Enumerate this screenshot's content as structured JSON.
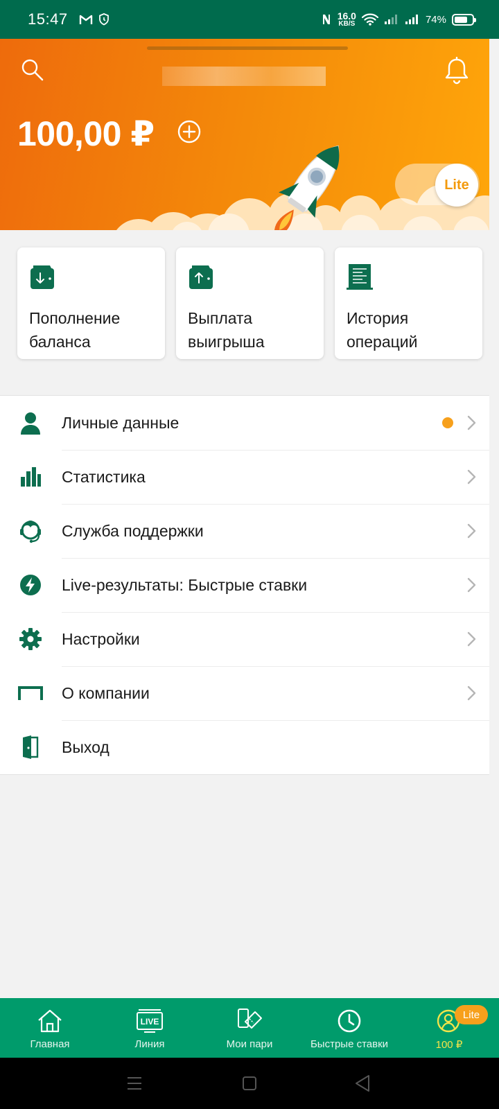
{
  "status_bar": {
    "time": "15:47",
    "net_speed_value": "16.0",
    "net_speed_unit": "KB/S",
    "battery": "74%",
    "battery_level": 0.74,
    "icons": [
      "gmail-icon",
      "shield-clock-icon",
      "nfc-icon",
      "wifi-icon",
      "signal-icon",
      "signal-icon",
      "battery-icon"
    ]
  },
  "header": {
    "balance": "100,00 ₽",
    "lite_toggle": "Lite",
    "colors": {
      "start": "#ee6b0c",
      "end": "#ffa60a"
    }
  },
  "actions": [
    {
      "label": "Пополнение баланса",
      "icon": "wallet-deposit-icon"
    },
    {
      "label": "Выплата выигрыша",
      "icon": "wallet-withdraw-icon"
    },
    {
      "label": "История операций",
      "icon": "receipt-icon"
    }
  ],
  "menu": [
    {
      "label": "Личные данные",
      "icon": "person-icon",
      "dot": true
    },
    {
      "label": "Статистика",
      "icon": "bar-chart-icon"
    },
    {
      "label": "Служба поддержки",
      "icon": "headset-icon"
    },
    {
      "label": "Live-результаты: Быстрые ставки",
      "icon": "lightning-icon"
    },
    {
      "label": "Настройки",
      "icon": "gear-icon"
    },
    {
      "label": "О компании",
      "icon": "goal-icon"
    },
    {
      "label": "Выход",
      "icon": "exit-door-icon"
    }
  ],
  "bottom_nav": [
    {
      "label": "Главная",
      "icon": "home-icon"
    },
    {
      "label": "Линия",
      "icon": "live-tv-icon",
      "icon_text": "LIVE"
    },
    {
      "label": "Мои пари",
      "icon": "ticket-icon"
    },
    {
      "label": "Быстрые ставки",
      "icon": "clock-icon"
    },
    {
      "label": "100 ₽",
      "icon": "profile-icon",
      "badge": "Lite"
    }
  ],
  "colors": {
    "brand_green": "#006b4d",
    "nav_green": "#009b6b",
    "accent_orange": "#f7a01c",
    "balance_yellow": "#f4e44a"
  }
}
